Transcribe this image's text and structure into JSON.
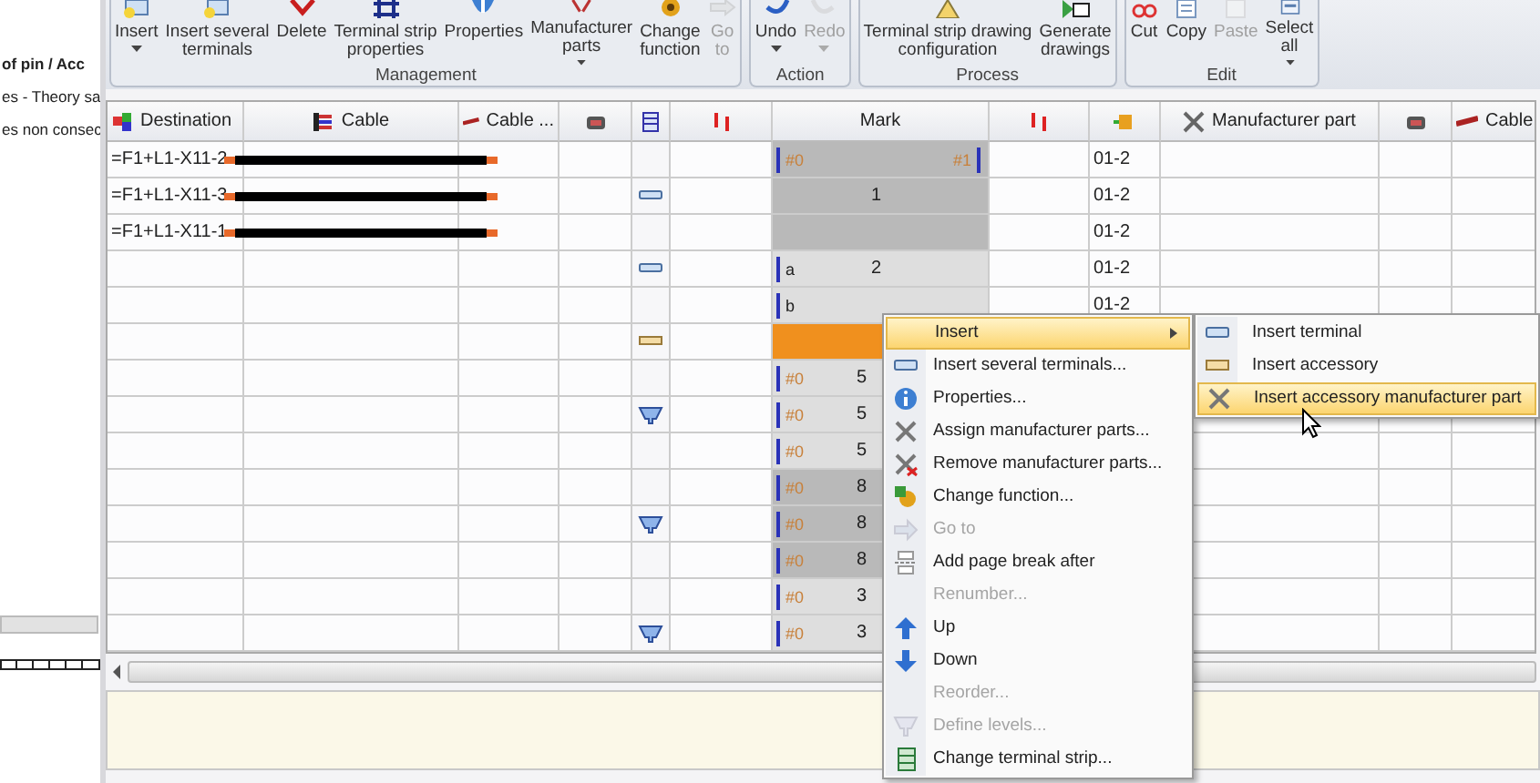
{
  "left_pane": {
    "lines": [
      {
        "text": "of pin / Acc",
        "bold": true
      },
      {
        "text": "es - Theory sa",
        "bold": false
      },
      {
        "text": "es non consec",
        "bold": false
      }
    ]
  },
  "ribbon": {
    "groups": [
      {
        "label": "Management",
        "buttons": [
          {
            "label": "Insert",
            "dropdown": true,
            "disabled": false
          },
          {
            "label": "Insert several\nterminals",
            "dropdown": false,
            "disabled": false
          },
          {
            "label": "Delete",
            "dropdown": false,
            "disabled": false
          },
          {
            "label": "Terminal strip\nproperties",
            "dropdown": false,
            "disabled": false
          },
          {
            "label": "Properties",
            "dropdown": false,
            "disabled": false
          },
          {
            "label": "Manufacturer\nparts",
            "dropdown": true,
            "disabled": false
          },
          {
            "label": "Change\nfunction",
            "dropdown": false,
            "disabled": false
          },
          {
            "label": "Go\nto",
            "dropdown": false,
            "disabled": true
          }
        ]
      },
      {
        "label": "Action",
        "buttons": [
          {
            "label": "Undo",
            "dropdown": true,
            "disabled": false
          },
          {
            "label": "Redo",
            "dropdown": true,
            "disabled": true
          }
        ]
      },
      {
        "label": "Process",
        "buttons": [
          {
            "label": "Terminal strip drawing\nconfiguration",
            "dropdown": false,
            "disabled": false
          },
          {
            "label": "Generate\ndrawings",
            "dropdown": false,
            "disabled": false
          }
        ]
      },
      {
        "label": "Edit",
        "buttons": [
          {
            "label": "Cut",
            "dropdown": false,
            "disabled": false
          },
          {
            "label": "Copy",
            "dropdown": false,
            "disabled": false
          },
          {
            "label": "Paste",
            "dropdown": false,
            "disabled": true
          },
          {
            "label": "Select\nall",
            "dropdown": true,
            "disabled": false
          }
        ]
      }
    ]
  },
  "table": {
    "columns": [
      {
        "kind": "labeled",
        "label": "Destination"
      },
      {
        "kind": "labeled",
        "label": "Cable"
      },
      {
        "kind": "labeled",
        "label": "Cable ..."
      },
      {
        "kind": "icon"
      },
      {
        "kind": "icon"
      },
      {
        "kind": "icon"
      },
      {
        "kind": "labeled",
        "label": "Mark"
      },
      {
        "kind": "icon"
      },
      {
        "kind": "icon"
      },
      {
        "kind": "labeled",
        "label": "Manufacturer part"
      },
      {
        "kind": "icon"
      },
      {
        "kind": "labeled",
        "label": "Cable"
      }
    ],
    "rows": [
      {
        "destination": "=F1+L1-X11-2",
        "has_cable": true,
        "kind": "plain",
        "mark_tag": "#0",
        "mark_tag_2": "#1",
        "mark_number": "",
        "dark": true,
        "selected": false,
        "column_9": "01-2"
      },
      {
        "destination": "=F1+L1-X11-3",
        "has_cable": true,
        "kind": "terminal",
        "mark_tag": "",
        "mark_tag_2": "",
        "mark_number": "1",
        "dark": true,
        "selected": false,
        "column_9": "01-2"
      },
      {
        "destination": "=F1+L1-X11-1",
        "has_cable": true,
        "kind": "plain",
        "mark_tag": "",
        "mark_tag_2": "",
        "mark_number": "",
        "dark": true,
        "selected": false,
        "column_9": "01-2"
      },
      {
        "destination": "",
        "has_cable": false,
        "kind": "terminal",
        "mark_tag": "a",
        "mark_tag_2": "",
        "mark_number": "2",
        "dark": false,
        "selected": false,
        "column_9": "01-2"
      },
      {
        "destination": "",
        "has_cable": false,
        "kind": "plain",
        "mark_tag": "b",
        "mark_tag_2": "",
        "mark_number": "",
        "dark": false,
        "selected": false,
        "column_9": "01-2"
      },
      {
        "destination": "",
        "has_cable": false,
        "kind": "accessory",
        "mark_tag": "",
        "mark_tag_2": "",
        "mark_number": "",
        "dark": false,
        "selected": true,
        "column_9": ""
      },
      {
        "destination": "",
        "has_cable": false,
        "kind": "plain",
        "mark_tag": "#0",
        "mark_tag_2": "",
        "mark_number": "5",
        "dark": false,
        "selected": false,
        "column_9": ""
      },
      {
        "destination": "",
        "has_cable": false,
        "kind": "level",
        "mark_tag": "#0",
        "mark_tag_2": "",
        "mark_number": "5",
        "dark": false,
        "selected": false,
        "column_9": ""
      },
      {
        "destination": "",
        "has_cable": false,
        "kind": "plain",
        "mark_tag": "#0",
        "mark_tag_2": "",
        "mark_number": "5",
        "dark": false,
        "selected": false,
        "column_9": ""
      },
      {
        "destination": "",
        "has_cable": false,
        "kind": "plain",
        "mark_tag": "#0",
        "mark_tag_2": "",
        "mark_number": "8",
        "dark": true,
        "selected": false,
        "column_9": ""
      },
      {
        "destination": "",
        "has_cable": false,
        "kind": "level",
        "mark_tag": "#0",
        "mark_tag_2": "",
        "mark_number": "8",
        "dark": true,
        "selected": false,
        "column_9": ""
      },
      {
        "destination": "",
        "has_cable": false,
        "kind": "plain",
        "mark_tag": "#0",
        "mark_tag_2": "",
        "mark_number": "8",
        "dark": true,
        "selected": false,
        "column_9": ""
      },
      {
        "destination": "",
        "has_cable": false,
        "kind": "plain",
        "mark_tag": "#0",
        "mark_tag_2": "",
        "mark_number": "3",
        "dark": false,
        "selected": false,
        "column_9": ""
      },
      {
        "destination": "",
        "has_cable": false,
        "kind": "level",
        "mark_tag": "#0",
        "mark_tag_2": "",
        "mark_number": "3",
        "dark": false,
        "selected": false,
        "column_9": ""
      }
    ]
  },
  "context_menu": {
    "items": [
      {
        "label": "Insert",
        "disabled": false,
        "selected": true,
        "has_submenu": true
      },
      {
        "label": "Insert several terminals...",
        "disabled": false,
        "selected": false,
        "has_submenu": false
      },
      {
        "label": "Properties...",
        "disabled": false,
        "selected": false,
        "has_submenu": false
      },
      {
        "label": "Assign manufacturer parts...",
        "disabled": false,
        "selected": false,
        "has_submenu": false
      },
      {
        "label": "Remove manufacturer parts...",
        "disabled": false,
        "selected": false,
        "has_submenu": false
      },
      {
        "label": "Change function...",
        "disabled": false,
        "selected": false,
        "has_submenu": false
      },
      {
        "label": "Go to",
        "disabled": true,
        "selected": false,
        "has_submenu": false
      },
      {
        "label": "Add page break after",
        "disabled": false,
        "selected": false,
        "has_submenu": false
      },
      {
        "label": "Renumber...",
        "disabled": true,
        "selected": false,
        "has_submenu": false
      },
      {
        "label": "Up",
        "disabled": false,
        "selected": false,
        "has_submenu": false
      },
      {
        "label": "Down",
        "disabled": false,
        "selected": false,
        "has_submenu": false
      },
      {
        "label": "Reorder...",
        "disabled": true,
        "selected": false,
        "has_submenu": false
      },
      {
        "label": "Define levels...",
        "disabled": true,
        "selected": false,
        "has_submenu": false
      },
      {
        "label": "Change terminal strip...",
        "disabled": false,
        "selected": false,
        "has_submenu": false
      }
    ]
  },
  "submenu": {
    "items": [
      {
        "label": "Insert terminal",
        "selected": false
      },
      {
        "label": "Insert accessory",
        "selected": false
      },
      {
        "label": "Insert accessory manufacturer part",
        "selected": true
      }
    ]
  }
}
